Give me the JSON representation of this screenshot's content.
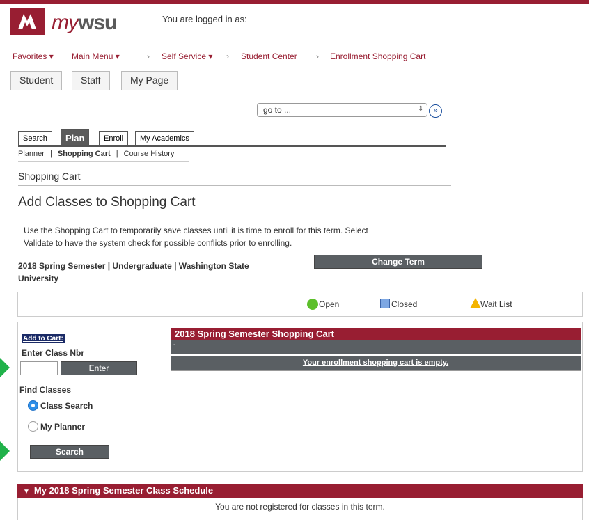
{
  "header": {
    "logo_my": "my",
    "logo_wsu": "wsu",
    "logged_in_text": "You are logged in as:"
  },
  "nav": {
    "favorites": "Favorites",
    "main_menu": "Main Menu",
    "self_service": "Self Service",
    "student_center": "Student Center",
    "enrollment_cart": "Enrollment Shopping Cart"
  },
  "portal_tabs": [
    "Student",
    "Staff",
    "My Page"
  ],
  "goto": {
    "value": "go to ..."
  },
  "subtabs": {
    "search": "Search",
    "plan": "Plan",
    "enroll": "Enroll",
    "my_academics": "My Academics"
  },
  "sublinks": {
    "planner": "Planner",
    "shopping_cart": "Shopping Cart",
    "course_history": "Course History",
    "sep": "|"
  },
  "page": {
    "section_title": "Shopping Cart",
    "heading": "Add Classes to Shopping Cart",
    "intro_line1": "Use the Shopping Cart to temporarily save classes until it is time to enroll for this term.  Select",
    "intro_line2": "Validate to have the system check for possible conflicts prior to enrolling.",
    "term_line1": "2018 Spring Semester | Undergraduate | Washington State",
    "term_line2": "University",
    "change_term_button": "Change Term"
  },
  "legend": {
    "open": "Open",
    "closed": "Closed",
    "wait_list": "Wait List"
  },
  "add_panel": {
    "add_to_cart": "Add to Cart:",
    "enter_class_nbr": "Enter Class Nbr",
    "class_nbr_value": "",
    "enter_button": "Enter",
    "find_classes": "Find Classes",
    "class_search": "Class Search",
    "my_planner": "My Planner",
    "selected_option": "Class Search",
    "search_button": "Search"
  },
  "cart": {
    "title": "2018 Spring Semester Shopping Cart",
    "gray_row": "-",
    "empty_message": "Your enrollment shopping cart is empty."
  },
  "schedule": {
    "title": "My 2018 Spring Semester Class Schedule",
    "message": "You are not registered for classes in this term."
  },
  "colors": {
    "crimson": "#981e32",
    "button_gray": "#5a5f63",
    "open_green": "#5cbf2a",
    "closed_blue": "#7da7e3",
    "waitlist_yellow": "#f4b400",
    "annotation_arrow": "#20b24a"
  }
}
